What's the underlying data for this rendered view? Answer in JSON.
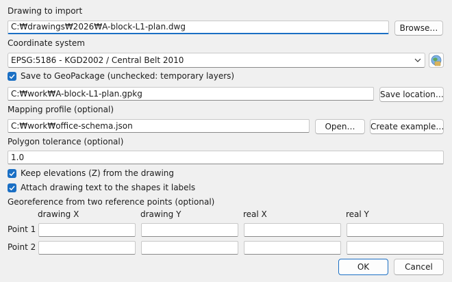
{
  "drawing": {
    "label": "Drawing to import",
    "path": "C:₩drawings₩2026₩A-block-L1-plan.dwg",
    "browse_label": "Browse…"
  },
  "crs": {
    "label": "Coordinate system",
    "selected": "EPSG:5186 - KGD2002 / Central Belt 2010",
    "picker_icon": "globe-select-icon"
  },
  "save": {
    "checkbox_label": "Save to GeoPackage (unchecked: temporary layers)",
    "checked": true,
    "path": "C:₩work₩A-block-L1-plan.gpkg",
    "location_label": "Save location…"
  },
  "mapping": {
    "label": "Mapping profile (optional)",
    "path": "C:₩work₩office-schema.json",
    "open_label": "Open…",
    "example_label": "Create example…"
  },
  "tolerance": {
    "label": "Polygon tolerance (optional)",
    "value": "1.0"
  },
  "options": {
    "keep_z_label": "Keep elevations (Z) from the drawing",
    "keep_z_checked": true,
    "attach_text_label": "Attach drawing text to the shapes it labels",
    "attach_text_checked": true
  },
  "georef": {
    "label": "Georeference from two reference points (optional)",
    "columns": [
      "drawing X",
      "drawing Y",
      "real X",
      "real Y"
    ],
    "rows": [
      {
        "label": "Point 1",
        "values": [
          "",
          "",
          "",
          ""
        ]
      },
      {
        "label": "Point 2",
        "values": [
          "",
          "",
          "",
          ""
        ]
      }
    ]
  },
  "footer": {
    "ok_label": "OK",
    "cancel_label": "Cancel"
  },
  "colors": {
    "accent": "#1a6fc4",
    "background": "#f0f0f0"
  }
}
